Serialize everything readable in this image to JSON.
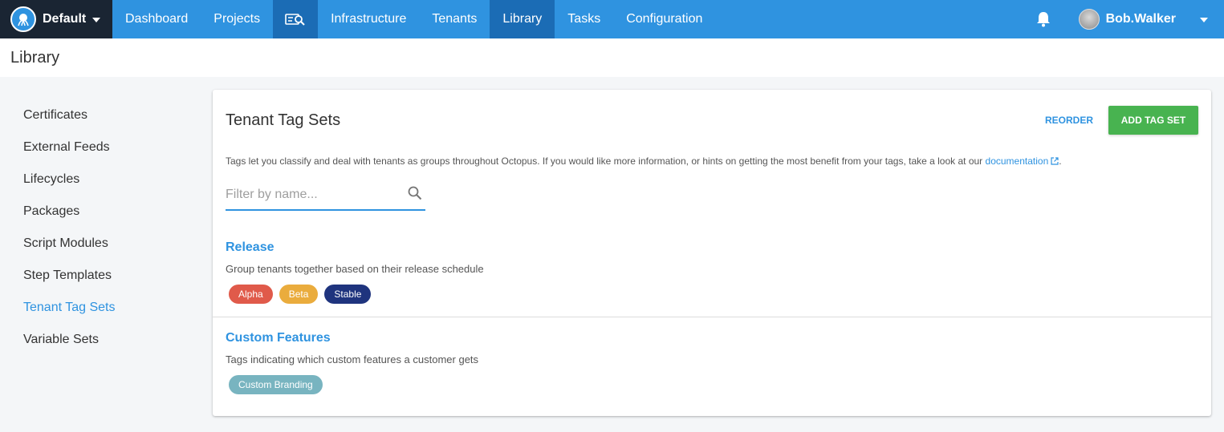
{
  "topnav": {
    "space_name": "Default",
    "items": [
      {
        "label": "Dashboard"
      },
      {
        "label": "Projects"
      },
      {
        "label": "Infrastructure"
      },
      {
        "label": "Tenants"
      },
      {
        "label": "Library"
      },
      {
        "label": "Tasks"
      },
      {
        "label": "Configuration"
      }
    ],
    "active_item": "Library",
    "user": "Bob.Walker",
    "icons": [
      "octopus-logo-icon",
      "search-deploy-icon",
      "bell-icon",
      "avatar",
      "chevron-down-icon"
    ]
  },
  "page": {
    "title": "Library"
  },
  "sidebar": {
    "items": [
      {
        "label": "Certificates"
      },
      {
        "label": "External Feeds"
      },
      {
        "label": "Lifecycles"
      },
      {
        "label": "Packages"
      },
      {
        "label": "Script Modules"
      },
      {
        "label": "Step Templates"
      },
      {
        "label": "Tenant Tag Sets"
      },
      {
        "label": "Variable Sets"
      }
    ],
    "active_item": "Tenant Tag Sets"
  },
  "card": {
    "title": "Tenant Tag Sets",
    "reorder_label": "REORDER",
    "add_label": "ADD TAG SET",
    "help_text": "Tags let you classify and deal with tenants as groups throughout Octopus. If you would like more information, or hints on getting the most benefit from your tags, take a look at our ",
    "help_link": "documentation",
    "help_end": ".",
    "filter_placeholder": "Filter by name...",
    "tag_sets": [
      {
        "name": "Release",
        "description": "Group tenants together based on their release schedule",
        "tags": [
          {
            "label": "Alpha",
            "color": "#e05a4a"
          },
          {
            "label": "Beta",
            "color": "#eaac3d"
          },
          {
            "label": "Stable",
            "color": "#1f347e"
          }
        ]
      },
      {
        "name": "Custom Features",
        "description": "Tags indicating which custom features a customer gets",
        "tags": [
          {
            "label": "Custom Branding",
            "color": "#78b4c0"
          }
        ]
      }
    ]
  },
  "colors": {
    "nav": "#2f93e0",
    "nav_active": "#1b6cb5",
    "space_bg": "#1a2533",
    "accent": "#2f93e0",
    "add_button": "#48b350"
  }
}
